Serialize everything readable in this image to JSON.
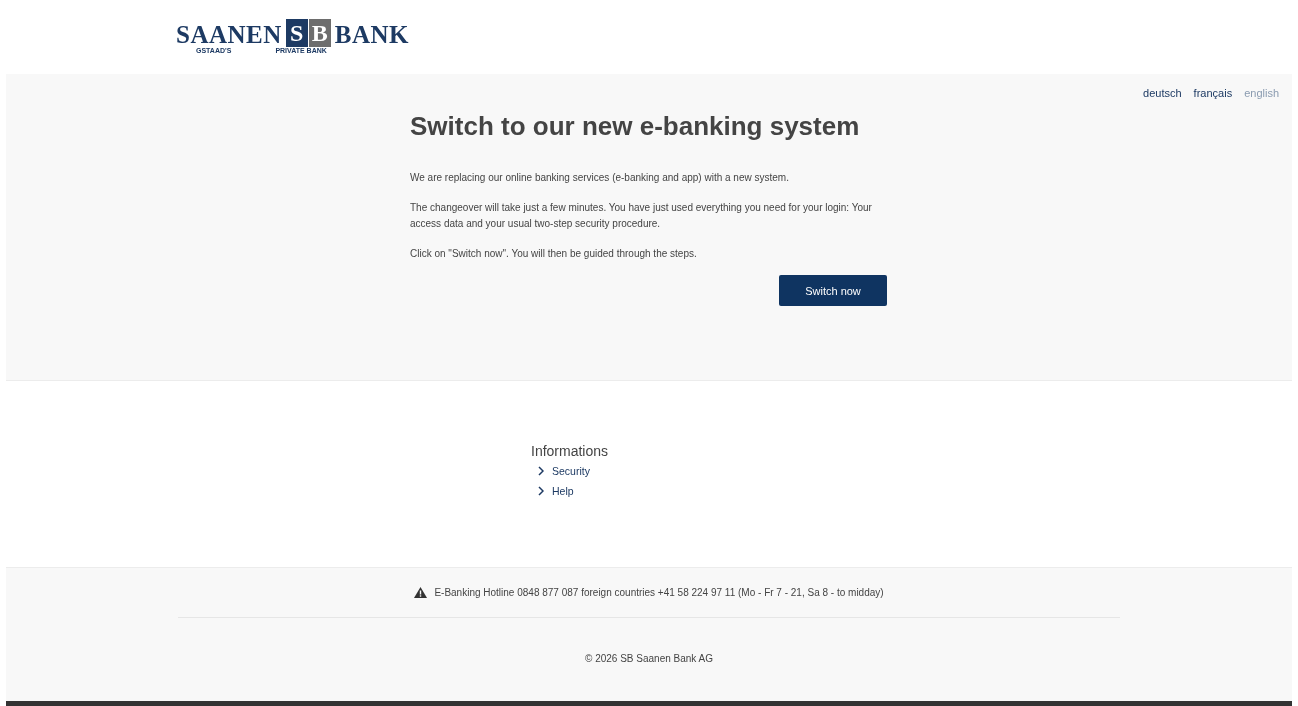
{
  "logo": {
    "left_word": "SAANEN",
    "monogram": [
      "S",
      "B"
    ],
    "right_word": "BANK",
    "left_caption": "GSTAAD'S",
    "right_caption": "PRIVATE BANK"
  },
  "languages": [
    {
      "label": "deutsch",
      "selected": false
    },
    {
      "label": "français",
      "selected": false
    },
    {
      "label": "english",
      "selected": true
    }
  ],
  "main": {
    "title": "Switch to our new e-banking system",
    "paragraphs": [
      "We are replacing our online banking services (e-banking and app) with a new system.",
      "The changeover will take just a few minutes. You have just used everything you need for your login: Your access data and your usual two-step security procedure.",
      "Click on \"Switch now\". You will then be guided through the steps."
    ],
    "button": "Switch now"
  },
  "informations": {
    "heading": "Informations",
    "links": [
      "Security",
      "Help"
    ]
  },
  "footer": {
    "hotline": "E-Banking Hotline 0848 877 087 foreign countries +41 58 224 97 11 (Mo - Fr 7 - 21, Sa 8 - to midday)",
    "copyright": "© 2026 SB Saanen Bank AG"
  }
}
